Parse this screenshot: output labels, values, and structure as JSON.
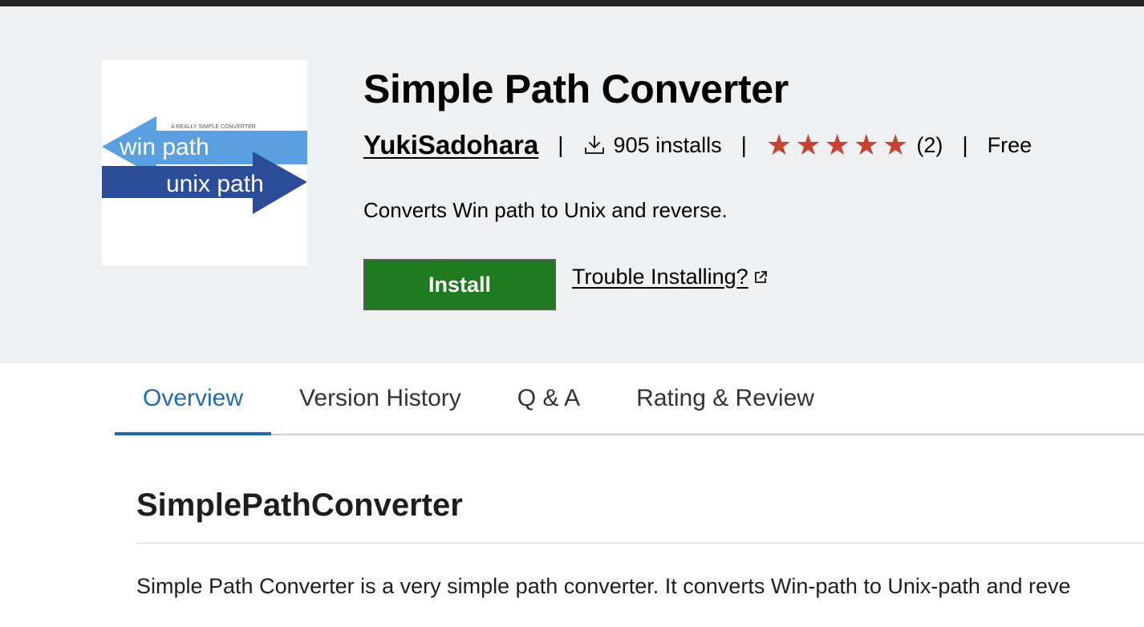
{
  "extension": {
    "title": "Simple Path Converter",
    "publisher": "YukiSadohara",
    "installs": "905 installs",
    "rating_count": "(2)",
    "rating_stars": 5,
    "price": "Free",
    "description": "Converts Win path to Unix and reverse.",
    "logo": {
      "tagline": "A REALLY SIMPLE CONVERTER",
      "top_arrow_text": "win path",
      "bottom_arrow_text": "unix path"
    }
  },
  "actions": {
    "install_label": "Install",
    "trouble_label": "Trouble Installing?"
  },
  "tabs": [
    {
      "label": "Overview",
      "active": true
    },
    {
      "label": "Version History",
      "active": false
    },
    {
      "label": "Q & A",
      "active": false
    },
    {
      "label": "Rating & Review",
      "active": false
    }
  ],
  "overview": {
    "heading": "SimplePathConverter",
    "paragraph": "Simple Path Converter is a very simple path converter. It converts Win-path to Unix-path and reve"
  },
  "colors": {
    "install_green": "#1e7a1e",
    "star_red": "#c9422f",
    "tab_active_blue": "#1f6bb0",
    "header_bg": "#eff0f2",
    "logo_light_blue": "#5a9fe0",
    "logo_dark_blue": "#2b4d99"
  },
  "icons": {
    "installs": "download-icon",
    "trouble": "external-link-icon",
    "rating": "star-icon"
  }
}
